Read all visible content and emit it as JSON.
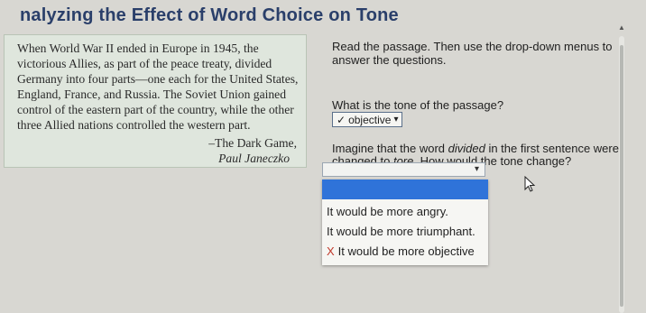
{
  "page": {
    "title": "nalyzing the Effect of Word Choice on Tone"
  },
  "passage": {
    "lines": [
      "When World War II ended in Europe in 1945, the",
      "victorious Allies, as part of the peace treaty, divided",
      "Germany into four parts—one each for the United States,",
      "England, France, and Russia. The Soviet Union gained",
      "control of the eastern part of the country, while the other",
      "three Allied nations controlled the western part."
    ],
    "source_title": "–The Dark Game,",
    "author": "Paul Janeczko"
  },
  "instructions": "Read the passage. Then use the drop-down menus to answer the questions.",
  "question1": {
    "text": "What is the tone of the passage?",
    "selected": "objective",
    "check_icon": "✓"
  },
  "question2": {
    "text_before": "Imagine that the word ",
    "word": "divided",
    "text_middle": " in the first sentence were changed to ",
    "replacement": "tore",
    "text_after": ". How would the tone change?"
  },
  "dropdown": {
    "options": [
      {
        "label": "It would be more angry."
      },
      {
        "label": "It would be more triumphant."
      },
      {
        "label": "It would be more objective",
        "mark": "X"
      }
    ]
  },
  "icons": {
    "caret": "chevron-down-icon",
    "cursor": "cursor-arrow-icon"
  },
  "colors": {
    "highlight": "#2f73d9",
    "title": "#2a3f6a",
    "wrong_mark": "#c0392b"
  }
}
